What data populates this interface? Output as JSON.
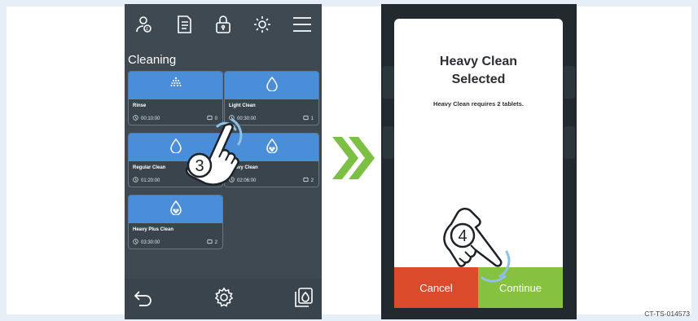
{
  "left_screen": {
    "header": {
      "icons": [
        "user-badge-icon",
        "document-icon",
        "lock-icon",
        "brightness-icon",
        "menu-icon"
      ]
    },
    "section_title": "Cleaning",
    "programs": [
      {
        "name": "Rinse",
        "time": "00:10:00",
        "tablets": "0",
        "icon": "rinse-spray-icon"
      },
      {
        "name": "Light Clean",
        "time": "00:30:00",
        "tablets": "1",
        "icon": "droplet-icon"
      },
      {
        "name": "Regular Clean",
        "time": "01:20:00",
        "tablets": "1",
        "icon": "droplet-icon"
      },
      {
        "name": "Heavy Clean",
        "time": "02:06:00",
        "tablets": "2",
        "icon": "droplet-dots-icon"
      },
      {
        "name": "Heavy Plus Clean",
        "time": "03:30:00",
        "tablets": "2",
        "icon": "droplet-dots-icon"
      }
    ],
    "footer": {
      "icons": [
        "back-arrow-icon",
        "settings-gear-icon",
        "copy-droplet-icon"
      ]
    },
    "step_marker": "3"
  },
  "right_screen": {
    "dialog": {
      "title_line1": "Heavy Clean",
      "title_line2": "Selected",
      "message": "Heavy Clean requires 2 tablets.",
      "cancel_label": "Cancel",
      "continue_label": "Continue"
    },
    "step_marker": "4"
  },
  "reference_code": "CT-TS-014573",
  "colors": {
    "screen_bg": "#3f4951",
    "tile_header": "#4a8ed9",
    "cancel": "#db4a2b",
    "continue": "#86c240",
    "arrow": "#7cc043"
  }
}
